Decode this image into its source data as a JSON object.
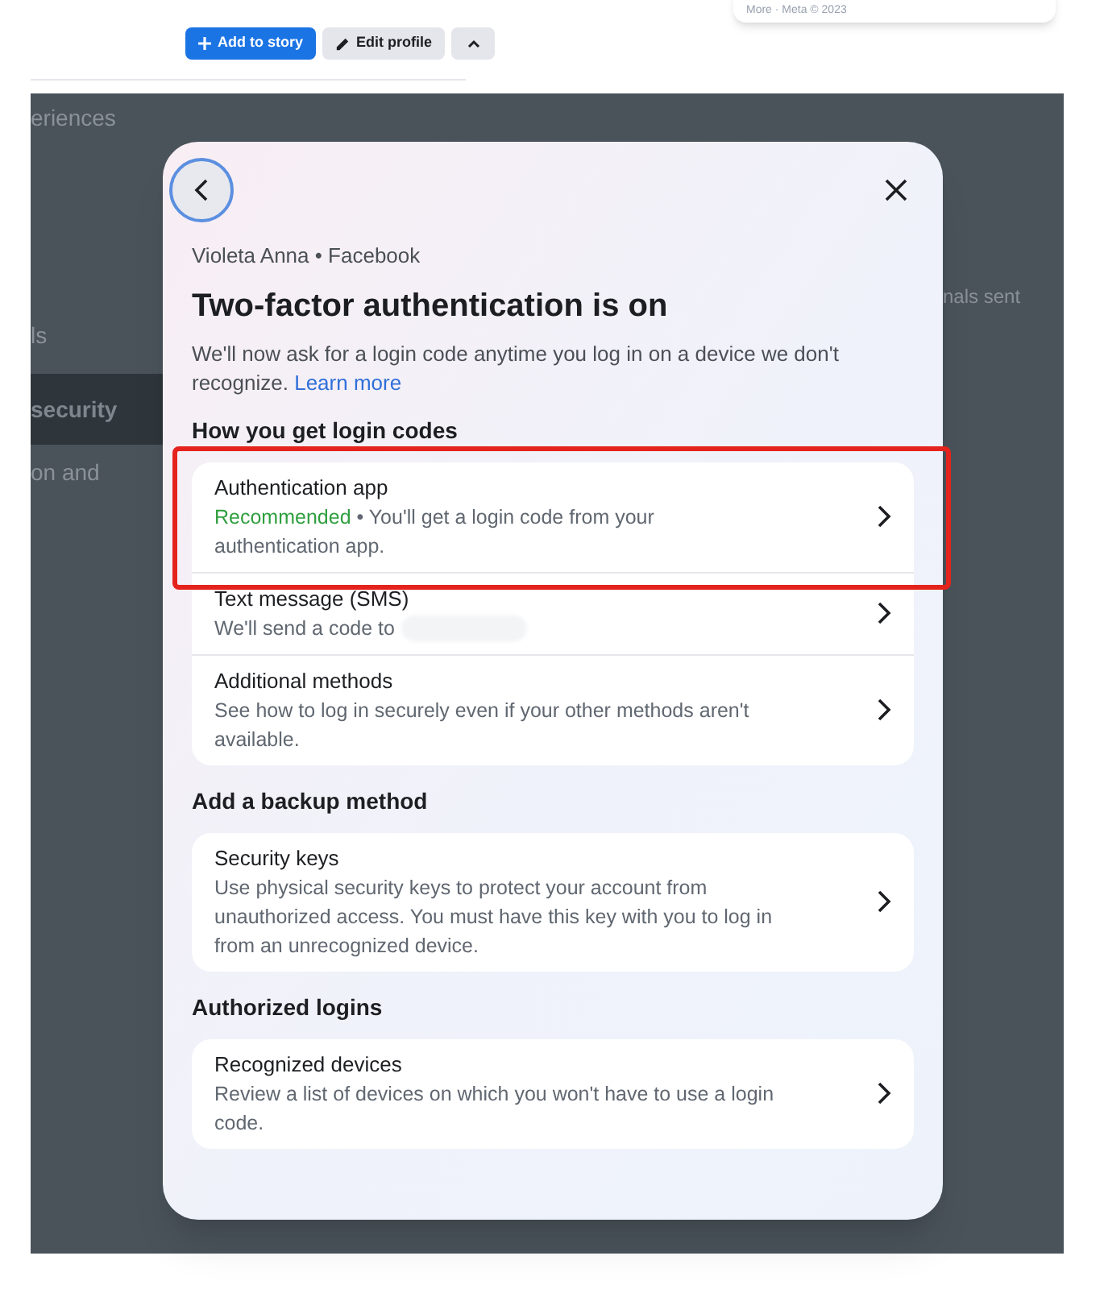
{
  "page": {
    "footer_card": "More · Meta © 2023",
    "buttons": [
      {
        "kind": "primary",
        "label": "Add to story"
      },
      {
        "kind": "secondary",
        "label": "Edit profile"
      },
      {
        "kind": "collapse"
      }
    ],
    "background_texts": [
      {
        "kind": "heading",
        "text": "eriences"
      },
      {
        "kind": "menu",
        "text": "ls",
        "selected": false
      },
      {
        "kind": "menu",
        "text": "security",
        "selected": true
      },
      {
        "kind": "menu",
        "text": "on and",
        "selected": false
      },
      {
        "kind": "note",
        "text": "nals sent"
      }
    ]
  },
  "dialog": {
    "account": "Violeta Anna • Facebook",
    "title": "Two-factor authentication is on",
    "description": "We'll now ask for a login code anytime you log in on a device we don't recognize.",
    "link": "Learn more",
    "sections": [
      {
        "heading": "How you get login codes",
        "items": [
          {
            "title": "Authentication app",
            "tag": "Recommended",
            "description": " • You'll get a login code from your authentication app.",
            "highlighted": true,
            "redacted": false
          },
          {
            "title": "Text message (SMS)",
            "description": "We'll send a code to",
            "highlighted": false,
            "redacted": true
          },
          {
            "title": "Additional methods",
            "description": "See how to log in securely even if your other methods aren't available.",
            "highlighted": false,
            "redacted": false
          }
        ]
      },
      {
        "heading": "Add a backup method",
        "items": [
          {
            "title": "Security keys",
            "description": "Use physical security keys to protect your account from unauthorized access. You must have this key with you to log in from an unrecognized device.",
            "highlighted": false,
            "redacted": false
          }
        ]
      },
      {
        "heading": "Authorized logins",
        "items": [
          {
            "title": "Recognized devices",
            "description": "Review a list of devices on which you won't have to use a login code.",
            "highlighted": false,
            "redacted": false
          }
        ]
      }
    ]
  }
}
